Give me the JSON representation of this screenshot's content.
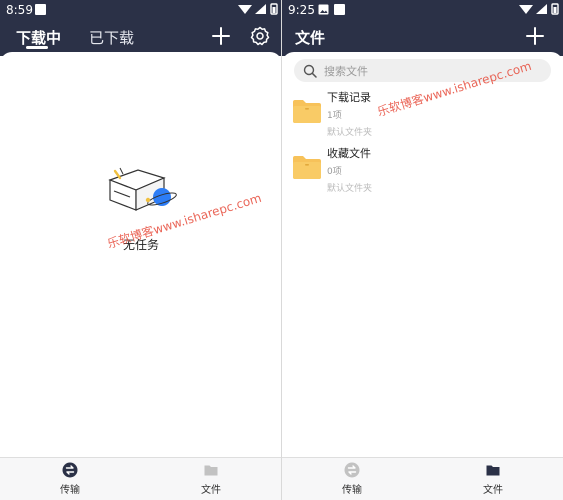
{
  "left": {
    "status": {
      "time": "8:59"
    },
    "tabs": [
      {
        "label": "下载中"
      },
      {
        "label": "已下载"
      }
    ],
    "empty_label": "无任务",
    "watermark": "乐软博客www.isharepc.com",
    "bottom_nav": [
      {
        "label": "传输"
      },
      {
        "label": "文件"
      }
    ]
  },
  "right": {
    "status": {
      "time": "9:25"
    },
    "title": "文件",
    "search": {
      "placeholder": "搜索文件"
    },
    "folders": [
      {
        "name": "下载记录",
        "count": "1项",
        "desc": "默认文件夹"
      },
      {
        "name": "收藏文件",
        "count": "0项",
        "desc": "默认文件夹"
      }
    ],
    "watermark": "乐软博客www.isharepc.com",
    "bottom_nav": [
      {
        "label": "传输"
      },
      {
        "label": "文件"
      }
    ]
  },
  "colors": {
    "header": "#2b3147",
    "folder": "#f7c25a",
    "watermark": "#e74c3c",
    "planet": "#2d7df6"
  },
  "icons": [
    "image-icon",
    "wifi-icon",
    "signal-icon",
    "battery-icon",
    "plus-icon",
    "gear-icon",
    "search-icon",
    "folder-icon",
    "transfer-icon",
    "empty-box-icon"
  ]
}
